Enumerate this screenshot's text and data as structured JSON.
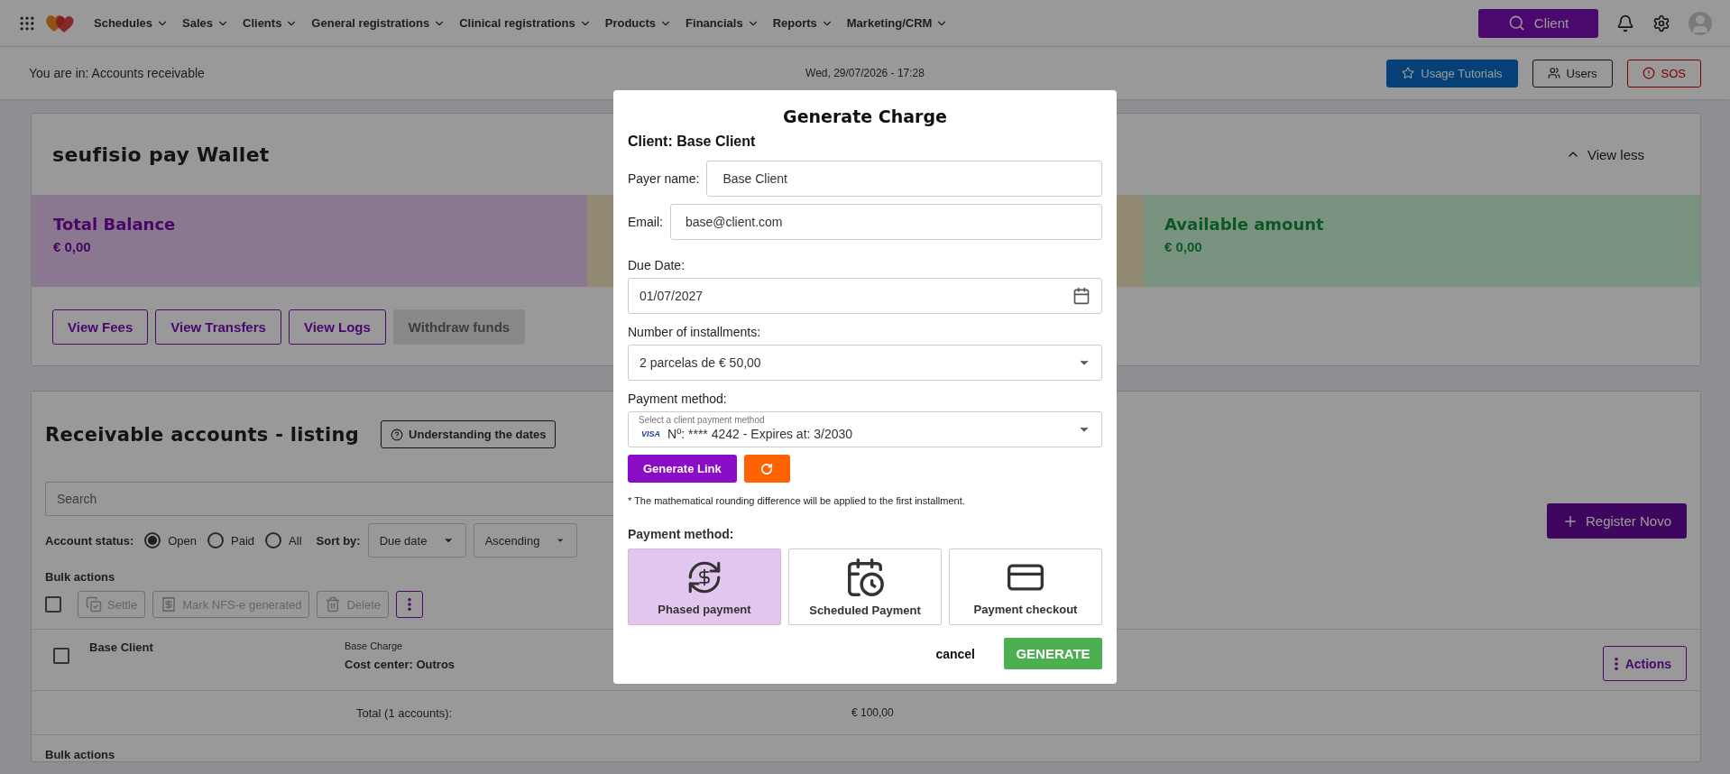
{
  "nav": {
    "menu": [
      "Schedules",
      "Sales",
      "Clients",
      "General registrations",
      "Clinical registrations",
      "Products",
      "Financials",
      "Reports",
      "Marketing/CRM"
    ],
    "search_button": "Client"
  },
  "subheader": {
    "breadcrumb": "You are in: Accounts receivable",
    "datetime": "Wed, 29/07/2026 - 17:28",
    "buttons": [
      {
        "label": "Usage Tutorials",
        "kind": "tutorials"
      },
      {
        "label": "Users",
        "kind": "users"
      },
      {
        "label": "SOS",
        "kind": "sos"
      }
    ]
  },
  "wallet": {
    "title": "seufisio pay Wallet",
    "toggle": "View less",
    "expanded": true,
    "balances": [
      {
        "kind": "total",
        "label": "Total Balance",
        "amount": "€ 0,00"
      },
      {
        "kind": "pending"
      },
      {
        "kind": "available",
        "label": "Available amount",
        "amount": "€ 0,00"
      }
    ],
    "buttons": [
      {
        "label": "View Fees",
        "disabled": false
      },
      {
        "label": "View Transfers",
        "disabled": false
      },
      {
        "label": "View Logs",
        "disabled": false
      },
      {
        "label": "Withdraw funds",
        "disabled": true
      }
    ]
  },
  "listing": {
    "title": "Receivable accounts - listing",
    "help_button": "Understanding the dates",
    "search": {
      "placeholder": "Search"
    },
    "status_label": "Account status:",
    "status_options": [
      {
        "label": "Open",
        "selected": true
      },
      {
        "label": "Paid",
        "selected": false
      },
      {
        "label": "All",
        "selected": false
      }
    ],
    "sort_label": "Sort by:",
    "sort_fields": [
      "Due date",
      "Ascending"
    ],
    "register_button": "Register Novo",
    "bulk_label": "Bulk actions",
    "bulk_checked": false,
    "bulk_buttons": [
      {
        "kind": "settle",
        "label": "Settle",
        "disabled": true
      },
      {
        "kind": "nfs",
        "label": "Mark NFS-e generated",
        "disabled": true
      },
      {
        "kind": "delete",
        "label": "Delete",
        "disabled": true
      }
    ],
    "rows": [
      {
        "client": "Base Client",
        "description": "Base Charge",
        "cost_center": "Cost center: Outros",
        "checked": false,
        "actions": "Actions"
      }
    ],
    "total_label": "Total (1 accounts):",
    "total_value": "€ 100,00",
    "bulk_label_bottom": "Bulk actions"
  },
  "modal": {
    "title": "Generate Charge",
    "client": "Client: Base Client",
    "payer_label": "Payer name:",
    "payer_value": "Base Client",
    "email_label": "Email:",
    "email_value": "base@client.com",
    "due_label": "Due Date:",
    "due_value": "01/07/2027",
    "installments_label": "Number of installments:",
    "installments_value": "2 parcelas de € 50,00",
    "method_label": "Payment method:",
    "method_hint": "Select a client payment method",
    "card_brand": "VISA",
    "card_text": "Nº: **** 4242 - Expires at: 3/2030",
    "generate_link": "Generate Link",
    "note": "* The mathematical rounding difference will be applied to the first installment.",
    "options_title": "Payment method:",
    "options": [
      {
        "kind": "phased",
        "label": "Phased payment",
        "selected": true
      },
      {
        "kind": "scheduled",
        "label": "Scheduled Payment",
        "selected": false
      },
      {
        "kind": "checkout",
        "label": "Payment checkout",
        "selected": false
      }
    ],
    "cancel": "cancel",
    "submit": "GENERATE"
  }
}
